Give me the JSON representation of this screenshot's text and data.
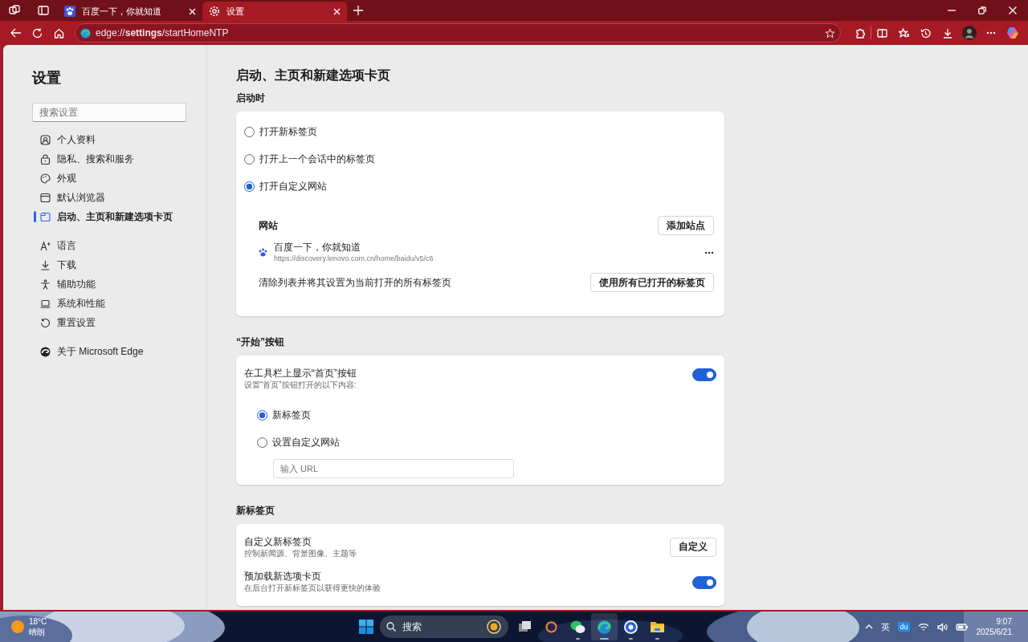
{
  "window": {
    "tabs": [
      {
        "title": "百度一下，你就知道",
        "selected": false
      },
      {
        "title": "设置",
        "selected": true
      }
    ],
    "address": "edge://**settings**/startHomeNTP"
  },
  "sidebar": {
    "title": "设置",
    "search": {
      "placeholder": "搜索设置"
    },
    "groups": [
      [
        {
          "label": "个人资料",
          "selected": false
        },
        {
          "label": "隐私、搜索和服务",
          "selected": false
        },
        {
          "label": "外观",
          "selected": false
        },
        {
          "label": "默认浏览器",
          "selected": false
        },
        {
          "label": "启动、主页和新建选项卡页",
          "selected": true
        }
      ],
      [
        {
          "label": "语言",
          "selected": false
        },
        {
          "label": "下载",
          "selected": false
        },
        {
          "label": "辅助功能",
          "selected": false
        },
        {
          "label": "系统和性能",
          "selected": false
        },
        {
          "label": "重置设置",
          "selected": false
        }
      ],
      [
        {
          "label": "关于 Microsoft Edge",
          "selected": false
        }
      ]
    ]
  },
  "main": {
    "title": "启动、主页和新建选项卡页",
    "startup": {
      "heading": "启动时",
      "options": [
        {
          "label": "打开新标签页",
          "selected": false
        },
        {
          "label": "打开上一个会话中的标签页",
          "selected": false
        },
        {
          "label": "打开自定义网站",
          "selected": true
        }
      ],
      "sites": {
        "heading": "网站",
        "add_button": "添加站点",
        "items": [
          {
            "title": "百度一下，你就知道",
            "url": "https://discovery.lenovo.com.cn/home/baidu/v5/c6"
          }
        ],
        "clear_text": "清除列表并将其设置为当前打开的所有标签页",
        "use_open_button": "使用所有已打开的标签页"
      }
    },
    "home_button": {
      "heading": "“开始”按钮",
      "label": "在工具栏上显示“首页”按钮",
      "description": "设置“首页”按钮打开的以下内容:",
      "on": true,
      "options": [
        {
          "label": "新标签页",
          "selected": true
        },
        {
          "label": "设置自定义网站",
          "selected": false
        }
      ],
      "url_field": {
        "placeholder": "输入 URL"
      }
    },
    "new_tab": {
      "heading": "新标签页",
      "rows": [
        {
          "kind": "button",
          "label": "自定义新标签页",
          "description": "控制新闻源、背景图像、主题等",
          "button": "自定义"
        },
        {
          "kind": "toggle",
          "label": "预加载新选项卡页",
          "description": "在后台打开新标签页以获得更快的体验",
          "on": true
        }
      ]
    }
  },
  "taskbar": {
    "weather": {
      "temperature": "18°C",
      "condition": "晴朗"
    },
    "search": {
      "placeholder": "搜索"
    },
    "apps": [
      {
        "running": false,
        "selected": false
      },
      {
        "running": false,
        "selected": false
      },
      {
        "running": true,
        "selected": false
      },
      {
        "running": true,
        "selected": true
      },
      {
        "running": true,
        "selected": false
      },
      {
        "running": true,
        "selected": false
      }
    ],
    "input_method": "英",
    "ime_logo": "du",
    "time": "9:07",
    "date": "2025/6/21"
  }
}
